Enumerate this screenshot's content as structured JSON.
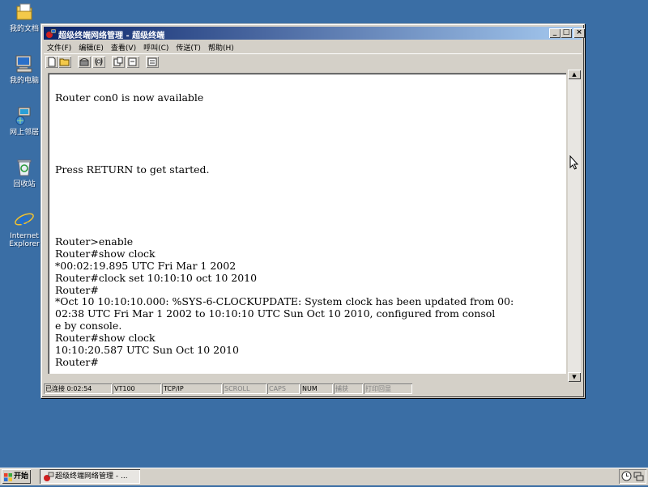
{
  "desktop": {
    "icons": [
      {
        "label": "我的文档",
        "icon": "my-documents-icon"
      },
      {
        "label": "我的电脑",
        "icon": "my-computer-icon"
      },
      {
        "label": "网上邻居",
        "icon": "network-places-icon"
      },
      {
        "label": "回收站",
        "icon": "recycle-bin-icon"
      },
      {
        "label": "Internet Explorer",
        "icon": "internet-explorer-icon"
      }
    ],
    "background_color": "#3a6ea5"
  },
  "window": {
    "title": "超级终端网络管理 - 超级终端",
    "title_gradient": [
      "#0a246a",
      "#a6caf0"
    ],
    "controls": {
      "minimize": "_",
      "maximize": "□",
      "close": "×"
    },
    "menu": [
      "文件(F)",
      "编辑(E)",
      "查看(V)",
      "呼叫(C)",
      "传送(T)",
      "帮助(H)"
    ],
    "toolbar": [
      "new-icon",
      "open-icon",
      "dial-icon",
      "disconnect-icon",
      "send-icon",
      "receive-icon",
      "properties-icon"
    ]
  },
  "terminal": {
    "text": "Router con0 is now available\n\n\n\n\n\nPress RETURN to get started.\n\n\n\n\n\nRouter>enable\nRouter#show clock\n*00:02:19.895 UTC Fri Mar 1 2002\nRouter#clock set 10:10:10 oct 10 2010\nRouter#\n*Oct 10 10:10:10.000: %SYS-6-CLOCKUPDATE: System clock has been updated from 00:\n02:38 UTC Fri Mar 1 2002 to 10:10:10 UTC Sun Oct 10 2010, configured from consol\ne by console.\nRouter#show clock\n10:10:20.587 UTC Sun Oct 10 2010\nRouter#"
  },
  "statusbar": {
    "connected": "已连接 0:02:54",
    "emulation": "VT100",
    "protocol": "TCP/IP",
    "scroll": "SCROLL",
    "caps": "CAPS",
    "num": "NUM",
    "capture": "捕获",
    "print_echo": "打印回显"
  },
  "taskbar": {
    "start_label": "开始",
    "task_label": "超级终端网络管理 - ..."
  }
}
